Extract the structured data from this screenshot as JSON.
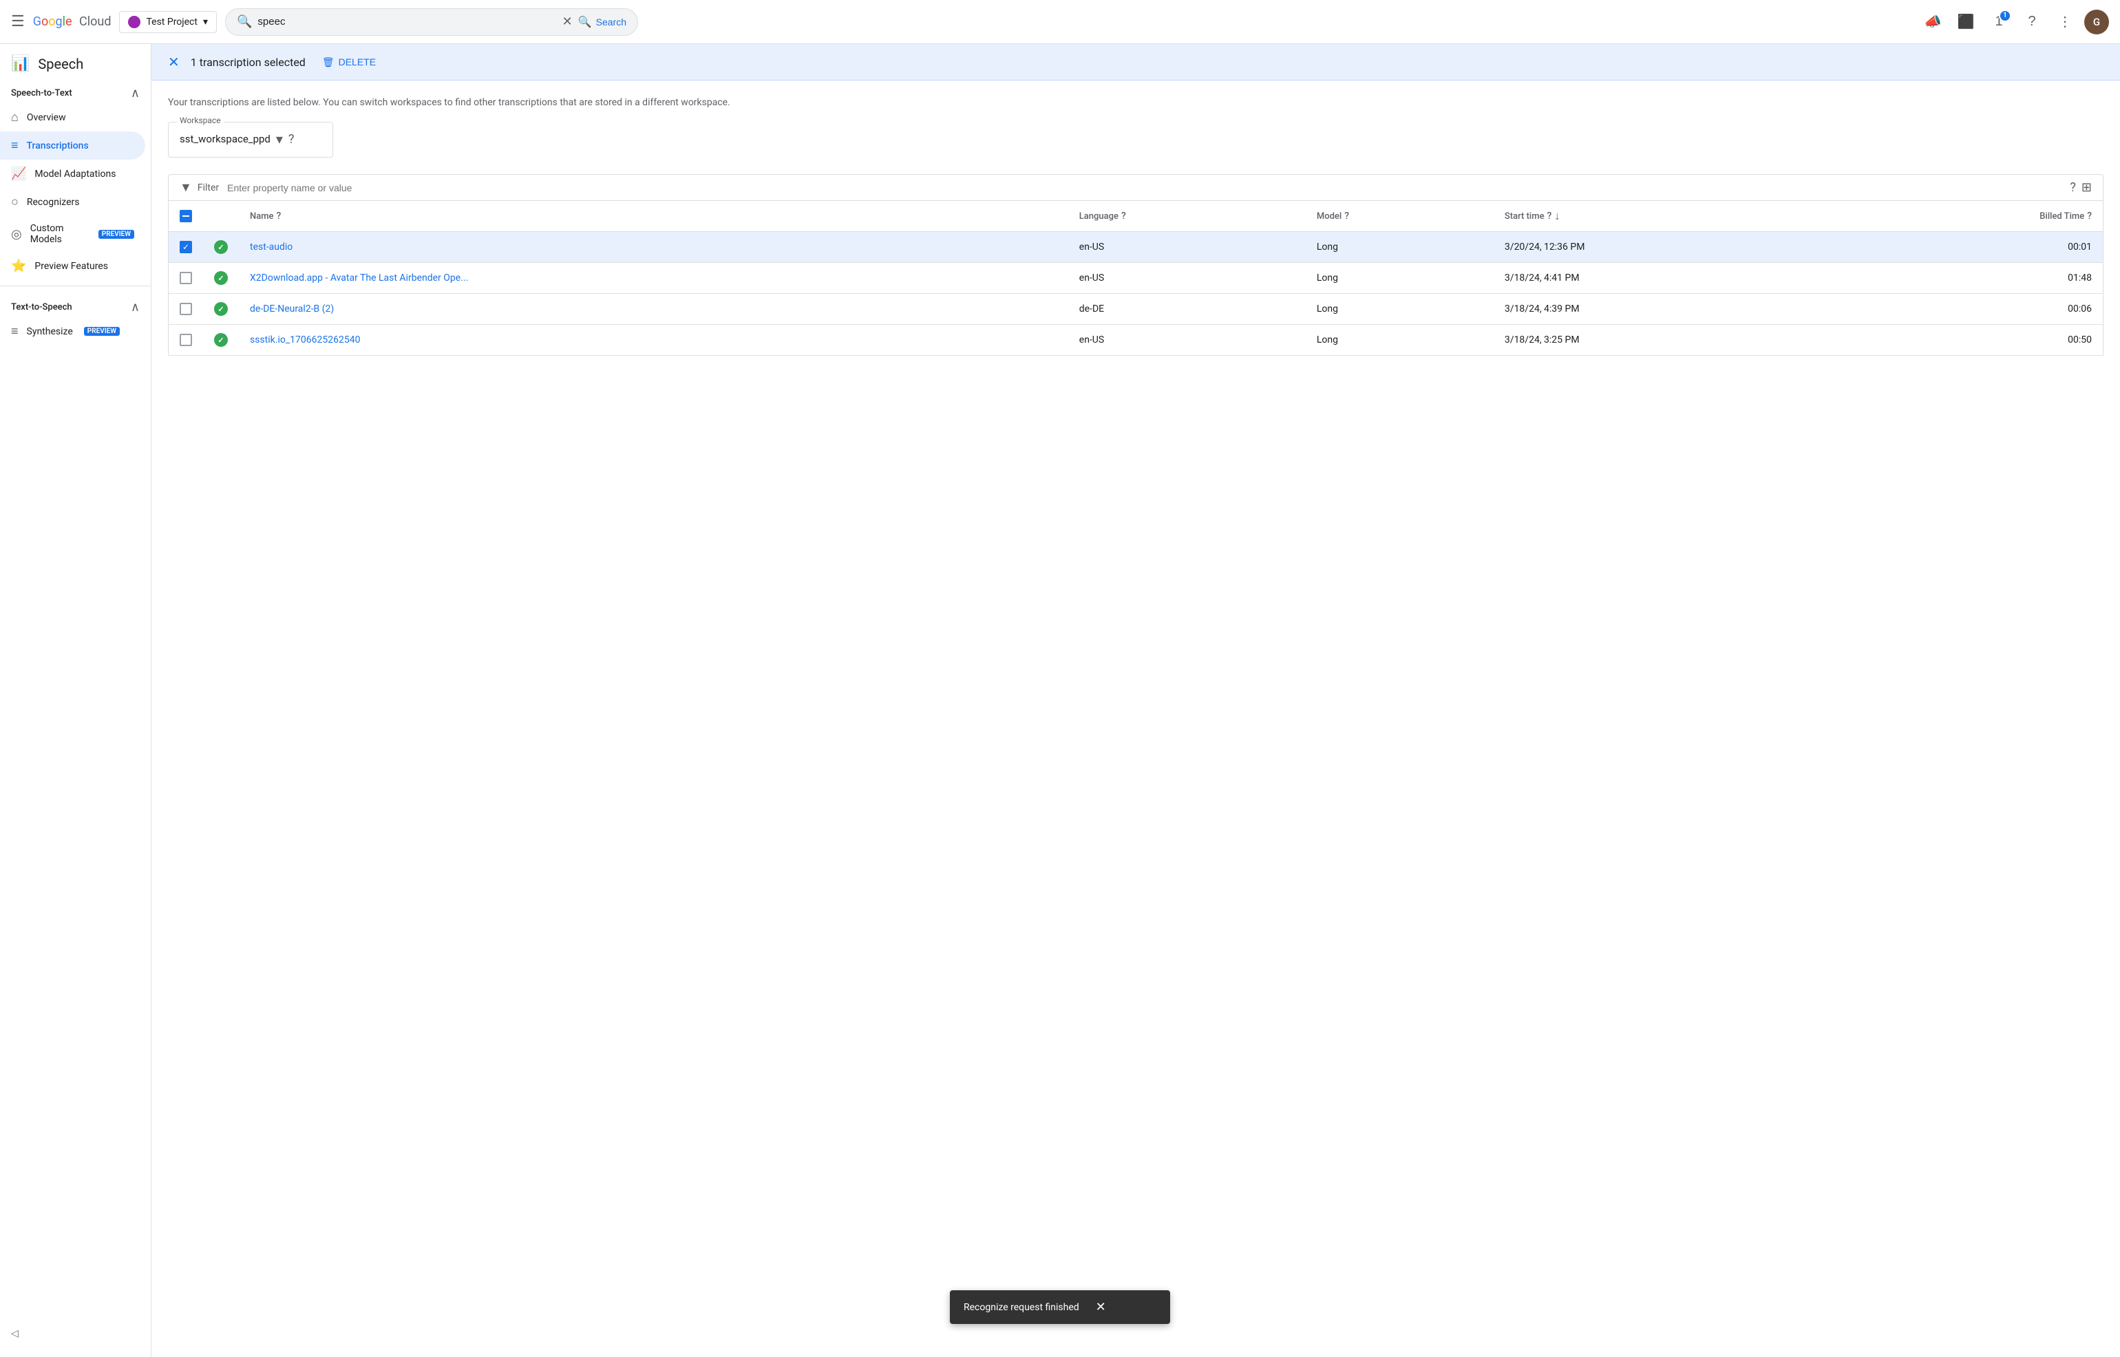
{
  "topNav": {
    "menuIcon": "☰",
    "logoText": "Google",
    "cloudText": "Cloud",
    "projectSelector": {
      "label": "Test Project",
      "chevron": "▾"
    },
    "search": {
      "value": "speec",
      "placeholder": "Search",
      "clearIcon": "✕",
      "buttonLabel": "Search"
    },
    "icons": {
      "notifications": "🔔",
      "terminal": "⬛",
      "notifBadge": "1",
      "help": "?",
      "more": "⋮",
      "avatar": "G"
    }
  },
  "sidebar": {
    "appIcon": "📊",
    "appTitle": "Speech",
    "speechToText": {
      "label": "Speech-to-Text",
      "chevron": "∧",
      "items": [
        {
          "id": "overview",
          "label": "Overview",
          "icon": "⌂",
          "active": false
        },
        {
          "id": "transcriptions",
          "label": "Transcriptions",
          "icon": "≡",
          "active": true
        },
        {
          "id": "model-adaptations",
          "label": "Model Adaptations",
          "icon": "📈",
          "active": false
        },
        {
          "id": "recognizers",
          "label": "Recognizers",
          "icon": "🔍",
          "active": false
        },
        {
          "id": "custom-models",
          "label": "Custom Models",
          "icon": "◎",
          "active": false,
          "badge": "PREVIEW"
        },
        {
          "id": "preview-features",
          "label": "Preview Features",
          "icon": "⭐",
          "active": false
        }
      ]
    },
    "textToSpeech": {
      "label": "Text-to-Speech",
      "chevron": "∧",
      "items": [
        {
          "id": "synthesize",
          "label": "Synthesize",
          "icon": "≡",
          "active": false,
          "badge": "PREVIEW"
        }
      ]
    },
    "collapseLabel": "◁"
  },
  "selectionBar": {
    "closeIcon": "✕",
    "countText": "1 transcription selected",
    "deleteIcon": "🗑",
    "deleteLabel": "DELETE"
  },
  "content": {
    "descriptionText": "Your transcriptions are listed below. You can switch workspaces to find other transcriptions that are stored in a different workspace.",
    "workspace": {
      "label": "Workspace",
      "value": "sst_workspace_ppd",
      "dropdownIcon": "▾",
      "helpIcon": "?"
    },
    "table": {
      "filterLabel": "Filter",
      "filterPlaceholder": "Enter property name or value",
      "columns": [
        {
          "id": "check",
          "label": ""
        },
        {
          "id": "status",
          "label": ""
        },
        {
          "id": "name",
          "label": "Name",
          "hasHelp": true
        },
        {
          "id": "language",
          "label": "Language",
          "hasHelp": true
        },
        {
          "id": "model",
          "label": "Model",
          "hasHelp": true
        },
        {
          "id": "startTime",
          "label": "Start time",
          "hasHelp": true,
          "sortable": true
        },
        {
          "id": "billedTime",
          "label": "Billed Time",
          "hasHelp": true
        }
      ],
      "rows": [
        {
          "id": "row1",
          "selected": true,
          "status": "success",
          "name": "test-audio",
          "language": "en-US",
          "model": "Long",
          "startTime": "3/20/24, 12:36 PM",
          "billedTime": "00:01"
        },
        {
          "id": "row2",
          "selected": false,
          "status": "success",
          "name": "X2Download.app - Avatar The Last Airbender Ope...",
          "language": "en-US",
          "model": "Long",
          "startTime": "3/18/24, 4:41 PM",
          "billedTime": "01:48"
        },
        {
          "id": "row3",
          "selected": false,
          "status": "success",
          "name": "de-DE-Neural2-B (2)",
          "language": "de-DE",
          "model": "Long",
          "startTime": "3/18/24, 4:39 PM",
          "billedTime": "00:06"
        },
        {
          "id": "row4",
          "selected": false,
          "status": "success",
          "name": "ssstik.io_1706625262540",
          "language": "en-US",
          "model": "Long",
          "startTime": "3/18/24, 3:25 PM",
          "billedTime": "00:50"
        }
      ]
    }
  },
  "snackbar": {
    "message": "Recognize request finished",
    "closeIcon": "✕"
  }
}
